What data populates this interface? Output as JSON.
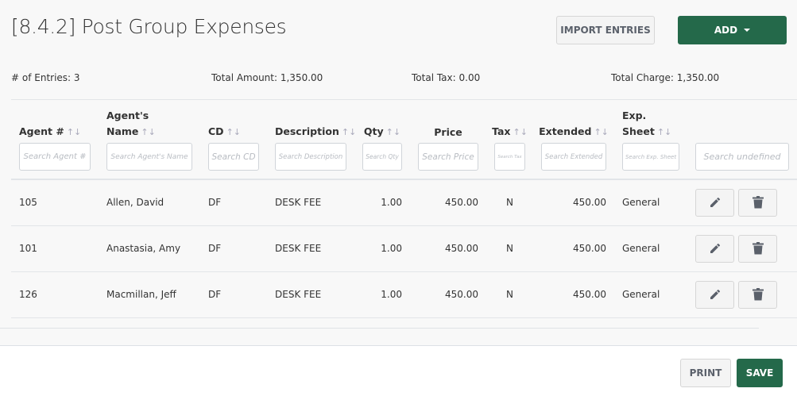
{
  "header": {
    "title": "[8.4.2] Post Group Expenses",
    "import_label": "IMPORT ENTRIES",
    "add_label": "ADD"
  },
  "summary": {
    "entries": "# of Entries: 3",
    "amount": "Total Amount: 1,350.00",
    "tax": "Total Tax: 0.00",
    "charge": "Total Charge: 1,350.00"
  },
  "columns": [
    {
      "label": "Agent #",
      "placeholder": "Search Agent #"
    },
    {
      "label": "Agent's Name",
      "placeholder": "Search Agent's Name"
    },
    {
      "label": "CD",
      "placeholder": "Search CD"
    },
    {
      "label": "Description",
      "placeholder": "Search Description"
    },
    {
      "label": "Qty",
      "placeholder": "Search Qty"
    },
    {
      "label": "Price",
      "placeholder": "Search Price"
    },
    {
      "label": "Tax",
      "placeholder": "Search Tax"
    },
    {
      "label": "Extended",
      "placeholder": "Search Extended"
    },
    {
      "label": "Exp. Sheet",
      "placeholder": "Search Exp. Sheet"
    },
    {
      "label": "",
      "placeholder": "Search undefined"
    }
  ],
  "rows": [
    [
      "105",
      "Allen, David",
      "DF",
      "DESK FEE",
      "1.00",
      "450.00",
      "N",
      "450.00",
      "General"
    ],
    [
      "101",
      "Anastasia, Amy",
      "DF",
      "DESK FEE",
      "1.00",
      "450.00",
      "N",
      "450.00",
      "General"
    ],
    [
      "126",
      "Macmillan, Jeff",
      "DF",
      "DESK FEE",
      "1.00",
      "450.00",
      "N",
      "450.00",
      "General"
    ]
  ],
  "footer": {
    "print_label": "PRINT",
    "save_label": "SAVE"
  }
}
